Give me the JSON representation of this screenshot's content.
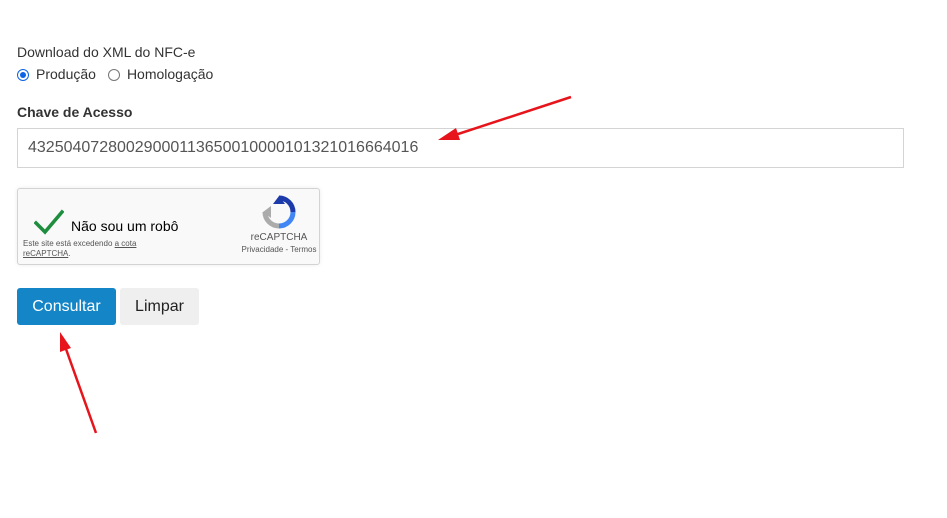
{
  "download": {
    "title": "Download do XML do NFC-e",
    "environments": [
      {
        "label": "Produção",
        "checked": true
      },
      {
        "label": "Homologação",
        "checked": false
      }
    ]
  },
  "access_key": {
    "label": "Chave de Acesso",
    "value": "43250407280029000113650010000101321016664016"
  },
  "recaptcha": {
    "label": "Não sou um robô",
    "quota_text": "Este site está excedendo",
    "quota_link": "a cota",
    "quota_text_2": "reCAPTCHA",
    "brand": "reCAPTCHA",
    "privacy": "Privacidade",
    "terms": "Termos",
    "check_color": "#1e8e3e"
  },
  "buttons": {
    "consult": "Consultar",
    "clear": "Limpar"
  },
  "colors": {
    "primary": "#1485c6",
    "annotation_arrow": "#e8141b"
  }
}
